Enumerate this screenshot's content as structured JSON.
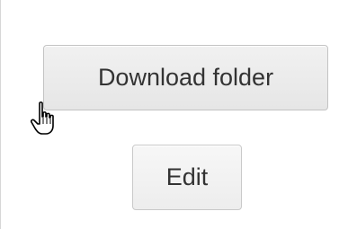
{
  "buttons": {
    "download_label": "Download folder",
    "edit_label": "Edit"
  },
  "cursor": {
    "icon": "pointer-hand-icon"
  },
  "colors": {
    "button_text": "#333333",
    "button_border": "#c9c9c9",
    "button_bg": "#f0f0f0"
  }
}
